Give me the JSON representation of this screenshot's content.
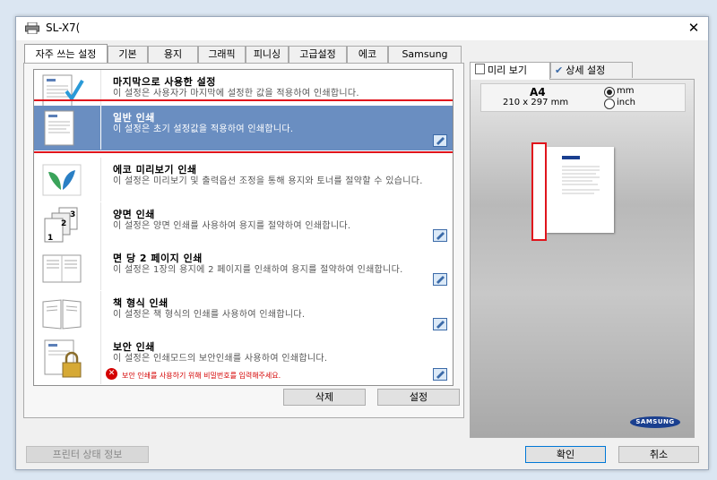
{
  "window": {
    "title": "SL-X7(",
    "close_glyph": "✕"
  },
  "tabs": [
    "자주 쓰는 설정",
    "기본",
    "용지",
    "그래픽",
    "피니싱",
    "고급설정",
    "에코",
    "Samsung"
  ],
  "presets": [
    {
      "title": "마지막으로 사용한 설정",
      "desc": "이 설정은 사용자가 마지막에 설정한 값을 적용하여 인쇄합니다.",
      "icon": "last-used-doc-icon"
    },
    {
      "title": "일반 인쇄",
      "desc": "이 설정은 초기 설정값을 적용하여 인쇄합니다.",
      "icon": "normal-print-doc-icon",
      "selected": true
    },
    {
      "title": "에코 미리보기 인쇄",
      "desc": "이 설정은 미리보기 및 출력옵션 조정을 통해 용지와 토너를 절약할 수 있습니다.",
      "icon": "eco-leaf-icon"
    },
    {
      "title": "양면 인쇄",
      "desc": "이 설정은 양면 인쇄를 사용하여 용지를 절약하여 인쇄합니다.",
      "icon": "duplex-123-icon"
    },
    {
      "title": "면 당 2 페이지 인쇄",
      "desc": "이 설정은 1장의 용지에 2 페이지를 인쇄하여 용지를 절약하여 인쇄합니다.",
      "icon": "two-up-pages-icon"
    },
    {
      "title": "책 형식 인쇄",
      "desc": "이 설정은 책 형식의 인쇄를 사용하여 인쇄합니다.",
      "icon": "booklet-icon"
    },
    {
      "title": "보안 인쇄",
      "desc": "이 설정은 인쇄모드의 보안인쇄를 사용하여 인쇄합니다.",
      "icon": "secure-lock-icon",
      "warning": "보안 인쇄를 사용하기 위해 비밀번호를 입력해주세요."
    }
  ],
  "buttons": {
    "delete": "삭제",
    "settings": "설정",
    "printer_status": "프린터 상태 정보",
    "ok": "확인",
    "cancel": "취소"
  },
  "preview_tabs": [
    "미리 보기",
    "상세 설정"
  ],
  "paper": {
    "name": "A4",
    "dims": "210 x 297 mm",
    "unit_mm": "mm",
    "unit_inch": "inch",
    "selected_unit": "mm"
  },
  "brand": "SAMSUNG",
  "colors": {
    "selection": "#6a8ec1",
    "highlight_border": "#e0141c",
    "samsung_blue": "#1a3f8f"
  }
}
